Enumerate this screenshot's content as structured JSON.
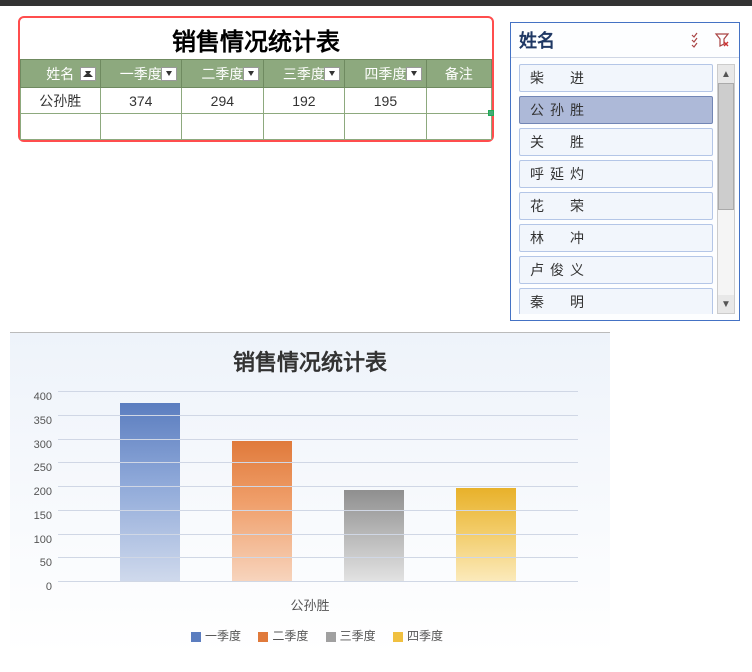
{
  "table": {
    "title": "销售情况统计表",
    "headers": [
      "姓名",
      "一季度",
      "二季度",
      "三季度",
      "四季度",
      "备注"
    ],
    "rows": [
      {
        "name": "公孙胜",
        "q1": "374",
        "q2": "294",
        "q3": "192",
        "q4": "195",
        "remark": ""
      }
    ]
  },
  "slicer": {
    "title": "姓名",
    "items": [
      "柴　进",
      "公孙胜",
      "关　胜",
      "呼延灼",
      "花　荣",
      "林　冲",
      "卢俊义",
      "秦　明"
    ],
    "selected_index": 1
  },
  "chart_data": {
    "type": "bar",
    "title": "销售情况统计表",
    "categories": [
      "公孙胜"
    ],
    "series": [
      {
        "name": "一季度",
        "values": [
          374
        ],
        "color": "#5b7dbf"
      },
      {
        "name": "二季度",
        "values": [
          294
        ],
        "color": "#e07a3b"
      },
      {
        "name": "三季度",
        "values": [
          192
        ],
        "color": "#a0a0a0"
      },
      {
        "name": "四季度",
        "values": [
          195
        ],
        "color": "#f0c040"
      }
    ],
    "ylabel": "",
    "xlabel": "",
    "ylim": [
      0,
      400
    ],
    "y_ticks": [
      0,
      50,
      100,
      150,
      200,
      250,
      300,
      350,
      400
    ]
  }
}
